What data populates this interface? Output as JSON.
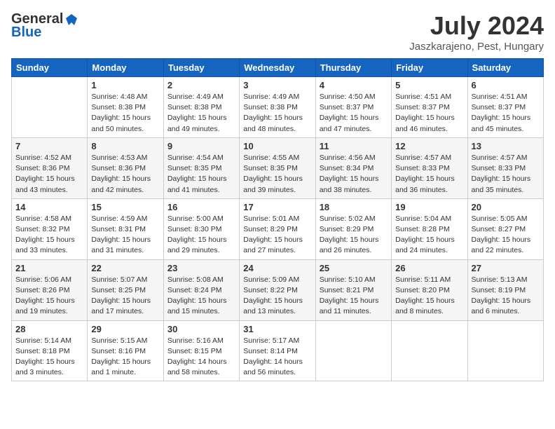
{
  "logo": {
    "general": "General",
    "blue": "Blue"
  },
  "title": {
    "month": "July 2024",
    "location": "Jaszkarajeno, Pest, Hungary"
  },
  "headers": [
    "Sunday",
    "Monday",
    "Tuesday",
    "Wednesday",
    "Thursday",
    "Friday",
    "Saturday"
  ],
  "weeks": [
    [
      {
        "day": "",
        "info": ""
      },
      {
        "day": "1",
        "info": "Sunrise: 4:48 AM\nSunset: 8:38 PM\nDaylight: 15 hours\nand 50 minutes."
      },
      {
        "day": "2",
        "info": "Sunrise: 4:49 AM\nSunset: 8:38 PM\nDaylight: 15 hours\nand 49 minutes."
      },
      {
        "day": "3",
        "info": "Sunrise: 4:49 AM\nSunset: 8:38 PM\nDaylight: 15 hours\nand 48 minutes."
      },
      {
        "day": "4",
        "info": "Sunrise: 4:50 AM\nSunset: 8:37 PM\nDaylight: 15 hours\nand 47 minutes."
      },
      {
        "day": "5",
        "info": "Sunrise: 4:51 AM\nSunset: 8:37 PM\nDaylight: 15 hours\nand 46 minutes."
      },
      {
        "day": "6",
        "info": "Sunrise: 4:51 AM\nSunset: 8:37 PM\nDaylight: 15 hours\nand 45 minutes."
      }
    ],
    [
      {
        "day": "7",
        "info": "Sunrise: 4:52 AM\nSunset: 8:36 PM\nDaylight: 15 hours\nand 43 minutes."
      },
      {
        "day": "8",
        "info": "Sunrise: 4:53 AM\nSunset: 8:36 PM\nDaylight: 15 hours\nand 42 minutes."
      },
      {
        "day": "9",
        "info": "Sunrise: 4:54 AM\nSunset: 8:35 PM\nDaylight: 15 hours\nand 41 minutes."
      },
      {
        "day": "10",
        "info": "Sunrise: 4:55 AM\nSunset: 8:35 PM\nDaylight: 15 hours\nand 39 minutes."
      },
      {
        "day": "11",
        "info": "Sunrise: 4:56 AM\nSunset: 8:34 PM\nDaylight: 15 hours\nand 38 minutes."
      },
      {
        "day": "12",
        "info": "Sunrise: 4:57 AM\nSunset: 8:33 PM\nDaylight: 15 hours\nand 36 minutes."
      },
      {
        "day": "13",
        "info": "Sunrise: 4:57 AM\nSunset: 8:33 PM\nDaylight: 15 hours\nand 35 minutes."
      }
    ],
    [
      {
        "day": "14",
        "info": "Sunrise: 4:58 AM\nSunset: 8:32 PM\nDaylight: 15 hours\nand 33 minutes."
      },
      {
        "day": "15",
        "info": "Sunrise: 4:59 AM\nSunset: 8:31 PM\nDaylight: 15 hours\nand 31 minutes."
      },
      {
        "day": "16",
        "info": "Sunrise: 5:00 AM\nSunset: 8:30 PM\nDaylight: 15 hours\nand 29 minutes."
      },
      {
        "day": "17",
        "info": "Sunrise: 5:01 AM\nSunset: 8:29 PM\nDaylight: 15 hours\nand 27 minutes."
      },
      {
        "day": "18",
        "info": "Sunrise: 5:02 AM\nSunset: 8:29 PM\nDaylight: 15 hours\nand 26 minutes."
      },
      {
        "day": "19",
        "info": "Sunrise: 5:04 AM\nSunset: 8:28 PM\nDaylight: 15 hours\nand 24 minutes."
      },
      {
        "day": "20",
        "info": "Sunrise: 5:05 AM\nSunset: 8:27 PM\nDaylight: 15 hours\nand 22 minutes."
      }
    ],
    [
      {
        "day": "21",
        "info": "Sunrise: 5:06 AM\nSunset: 8:26 PM\nDaylight: 15 hours\nand 19 minutes."
      },
      {
        "day": "22",
        "info": "Sunrise: 5:07 AM\nSunset: 8:25 PM\nDaylight: 15 hours\nand 17 minutes."
      },
      {
        "day": "23",
        "info": "Sunrise: 5:08 AM\nSunset: 8:24 PM\nDaylight: 15 hours\nand 15 minutes."
      },
      {
        "day": "24",
        "info": "Sunrise: 5:09 AM\nSunset: 8:22 PM\nDaylight: 15 hours\nand 13 minutes."
      },
      {
        "day": "25",
        "info": "Sunrise: 5:10 AM\nSunset: 8:21 PM\nDaylight: 15 hours\nand 11 minutes."
      },
      {
        "day": "26",
        "info": "Sunrise: 5:11 AM\nSunset: 8:20 PM\nDaylight: 15 hours\nand 8 minutes."
      },
      {
        "day": "27",
        "info": "Sunrise: 5:13 AM\nSunset: 8:19 PM\nDaylight: 15 hours\nand 6 minutes."
      }
    ],
    [
      {
        "day": "28",
        "info": "Sunrise: 5:14 AM\nSunset: 8:18 PM\nDaylight: 15 hours\nand 3 minutes."
      },
      {
        "day": "29",
        "info": "Sunrise: 5:15 AM\nSunset: 8:16 PM\nDaylight: 15 hours\nand 1 minute."
      },
      {
        "day": "30",
        "info": "Sunrise: 5:16 AM\nSunset: 8:15 PM\nDaylight: 14 hours\nand 58 minutes."
      },
      {
        "day": "31",
        "info": "Sunrise: 5:17 AM\nSunset: 8:14 PM\nDaylight: 14 hours\nand 56 minutes."
      },
      {
        "day": "",
        "info": ""
      },
      {
        "day": "",
        "info": ""
      },
      {
        "day": "",
        "info": ""
      }
    ]
  ]
}
